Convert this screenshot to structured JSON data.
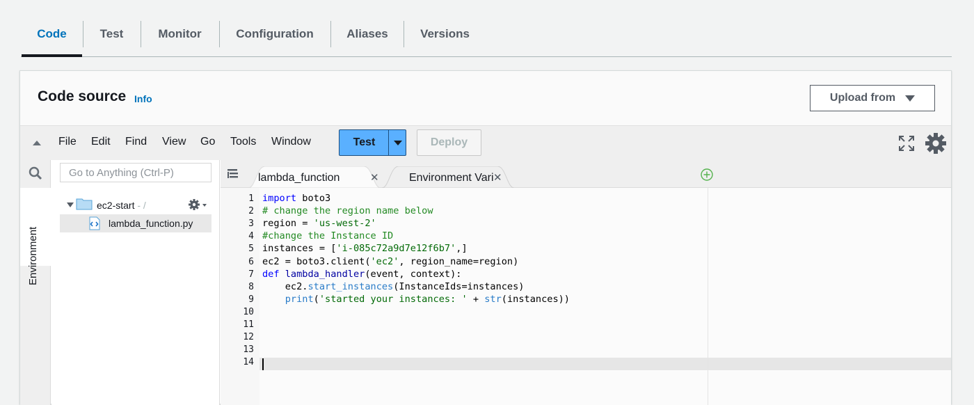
{
  "tabs": [
    {
      "label": "Code",
      "active": true
    },
    {
      "label": "Test"
    },
    {
      "label": "Monitor"
    },
    {
      "label": "Configuration"
    },
    {
      "label": "Aliases"
    },
    {
      "label": "Versions"
    }
  ],
  "panel": {
    "title": "Code source",
    "info_link": "Info",
    "upload_button": "Upload from"
  },
  "toolbar": {
    "menu": [
      "File",
      "Edit",
      "Find",
      "View",
      "Go",
      "Tools",
      "Window"
    ],
    "test_label": "Test",
    "deploy_label": "Deploy"
  },
  "sidebar": {
    "environment_label": "Environment",
    "search_placeholder": "Go to Anything (Ctrl-P)",
    "folder_name": "ec2-start",
    "folder_suffix": " - /",
    "file_name": "lambda_function.py"
  },
  "editor_tabs": [
    {
      "label": "lambda_function",
      "active": true
    },
    {
      "label": "Environment Vari"
    }
  ],
  "code": {
    "line_numbers": [
      "1",
      "2",
      "3",
      "4",
      "5",
      "6",
      "7",
      "8",
      "9",
      "10",
      "11",
      "12",
      "13",
      "14"
    ],
    "active_line": 14,
    "lines": [
      [
        {
          "t": "import",
          "c": "kw"
        },
        {
          "t": " boto3"
        }
      ],
      [
        {
          "t": "# change the region name below",
          "c": "cm"
        }
      ],
      [
        {
          "t": "region = "
        },
        {
          "t": "'us-west-2'",
          "c": "st"
        }
      ],
      [
        {
          "t": "#change the Instance ID",
          "c": "cm"
        }
      ],
      [
        {
          "t": "instances = ["
        },
        {
          "t": "'i-085c72a9d7e12f6b7'",
          "c": "st"
        },
        {
          "t": ",]"
        }
      ],
      [
        {
          "t": "ec2 = boto3.client("
        },
        {
          "t": "'ec2'",
          "c": "st"
        },
        {
          "t": ", region_name=region)"
        }
      ],
      [
        {
          "t": "def",
          "c": "kw"
        },
        {
          "t": " "
        },
        {
          "t": "lambda_handler",
          "c": "fn"
        },
        {
          "t": "(event, context):"
        }
      ],
      [
        {
          "t": "    ec2."
        },
        {
          "t": "start_instances",
          "c": "bi"
        },
        {
          "t": "(InstanceIds=instances)"
        }
      ],
      [
        {
          "t": "    "
        },
        {
          "t": "print",
          "c": "bi"
        },
        {
          "t": "("
        },
        {
          "t": "'started your instances: '",
          "c": "st"
        },
        {
          "t": " + "
        },
        {
          "t": "str",
          "c": "bi"
        },
        {
          "t": "(instances))"
        }
      ],
      [],
      [],
      [],
      [],
      []
    ]
  },
  "colors": {
    "accent": "#0073bb",
    "test_button": "#5ab0ff"
  }
}
